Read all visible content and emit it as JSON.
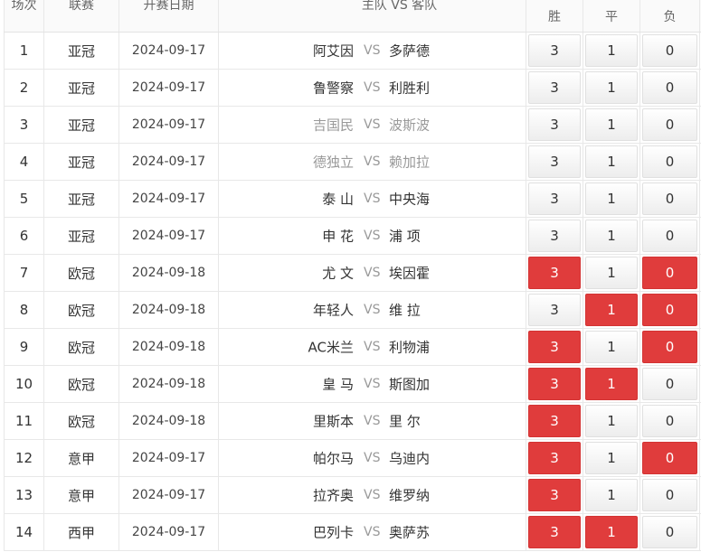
{
  "header": {
    "idx": "场次",
    "league": "联赛",
    "date": "开赛日期",
    "match": "主队 VS 客队",
    "win": "胜",
    "draw": "平",
    "loss": "负"
  },
  "vs_label": "VS",
  "colors": {
    "selected": "#e03c3c",
    "dim_text": "#999999"
  },
  "rows": [
    {
      "idx": "1",
      "league": "亚冠",
      "date": "2024-09-17",
      "home": "阿艾因",
      "away": "多萨德",
      "dim_home": false,
      "dim_away": false,
      "w": "3",
      "d": "1",
      "l": "0",
      "sel": [
        false,
        false,
        false
      ]
    },
    {
      "idx": "2",
      "league": "亚冠",
      "date": "2024-09-17",
      "home": "鲁警察",
      "away": "利胜利",
      "dim_home": false,
      "dim_away": false,
      "w": "3",
      "d": "1",
      "l": "0",
      "sel": [
        false,
        false,
        false
      ]
    },
    {
      "idx": "3",
      "league": "亚冠",
      "date": "2024-09-17",
      "home": "吉国民",
      "away": "波斯波",
      "dim_home": true,
      "dim_away": true,
      "w": "3",
      "d": "1",
      "l": "0",
      "sel": [
        false,
        false,
        false
      ]
    },
    {
      "idx": "4",
      "league": "亚冠",
      "date": "2024-09-17",
      "home": "德独立",
      "away": "赖加拉",
      "dim_home": true,
      "dim_away": true,
      "w": "3",
      "d": "1",
      "l": "0",
      "sel": [
        false,
        false,
        false
      ]
    },
    {
      "idx": "5",
      "league": "亚冠",
      "date": "2024-09-17",
      "home": "泰 山",
      "away": "中央海",
      "dim_home": false,
      "dim_away": false,
      "w": "3",
      "d": "1",
      "l": "0",
      "sel": [
        false,
        false,
        false
      ]
    },
    {
      "idx": "6",
      "league": "亚冠",
      "date": "2024-09-17",
      "home": "申 花",
      "away": "浦 项",
      "dim_home": false,
      "dim_away": false,
      "w": "3",
      "d": "1",
      "l": "0",
      "sel": [
        false,
        false,
        false
      ]
    },
    {
      "idx": "7",
      "league": "欧冠",
      "date": "2024-09-18",
      "home": "尤 文",
      "away": "埃因霍",
      "dim_home": false,
      "dim_away": false,
      "w": "3",
      "d": "1",
      "l": "0",
      "sel": [
        true,
        false,
        true
      ]
    },
    {
      "idx": "8",
      "league": "欧冠",
      "date": "2024-09-18",
      "home": "年轻人",
      "away": "维 拉",
      "dim_home": false,
      "dim_away": false,
      "w": "3",
      "d": "1",
      "l": "0",
      "sel": [
        false,
        true,
        true
      ]
    },
    {
      "idx": "9",
      "league": "欧冠",
      "date": "2024-09-18",
      "home": "AC米兰",
      "away": "利物浦",
      "dim_home": false,
      "dim_away": false,
      "w": "3",
      "d": "1",
      "l": "0",
      "sel": [
        true,
        false,
        true
      ]
    },
    {
      "idx": "10",
      "league": "欧冠",
      "date": "2024-09-18",
      "home": "皇 马",
      "away": "斯图加",
      "dim_home": false,
      "dim_away": false,
      "w": "3",
      "d": "1",
      "l": "0",
      "sel": [
        true,
        true,
        false
      ]
    },
    {
      "idx": "11",
      "league": "欧冠",
      "date": "2024-09-18",
      "home": "里斯本",
      "away": "里 尔",
      "dim_home": false,
      "dim_away": false,
      "w": "3",
      "d": "1",
      "l": "0",
      "sel": [
        true,
        false,
        false
      ]
    },
    {
      "idx": "12",
      "league": "意甲",
      "date": "2024-09-17",
      "home": "帕尔马",
      "away": "乌迪内",
      "dim_home": false,
      "dim_away": false,
      "w": "3",
      "d": "1",
      "l": "0",
      "sel": [
        true,
        false,
        true
      ]
    },
    {
      "idx": "13",
      "league": "意甲",
      "date": "2024-09-17",
      "home": "拉齐奥",
      "away": "维罗纳",
      "dim_home": false,
      "dim_away": false,
      "w": "3",
      "d": "1",
      "l": "0",
      "sel": [
        true,
        false,
        false
      ]
    },
    {
      "idx": "14",
      "league": "西甲",
      "date": "2024-09-17",
      "home": "巴列卡",
      "away": "奥萨苏",
      "dim_home": false,
      "dim_away": false,
      "w": "3",
      "d": "1",
      "l": "0",
      "sel": [
        true,
        true,
        false
      ]
    }
  ]
}
